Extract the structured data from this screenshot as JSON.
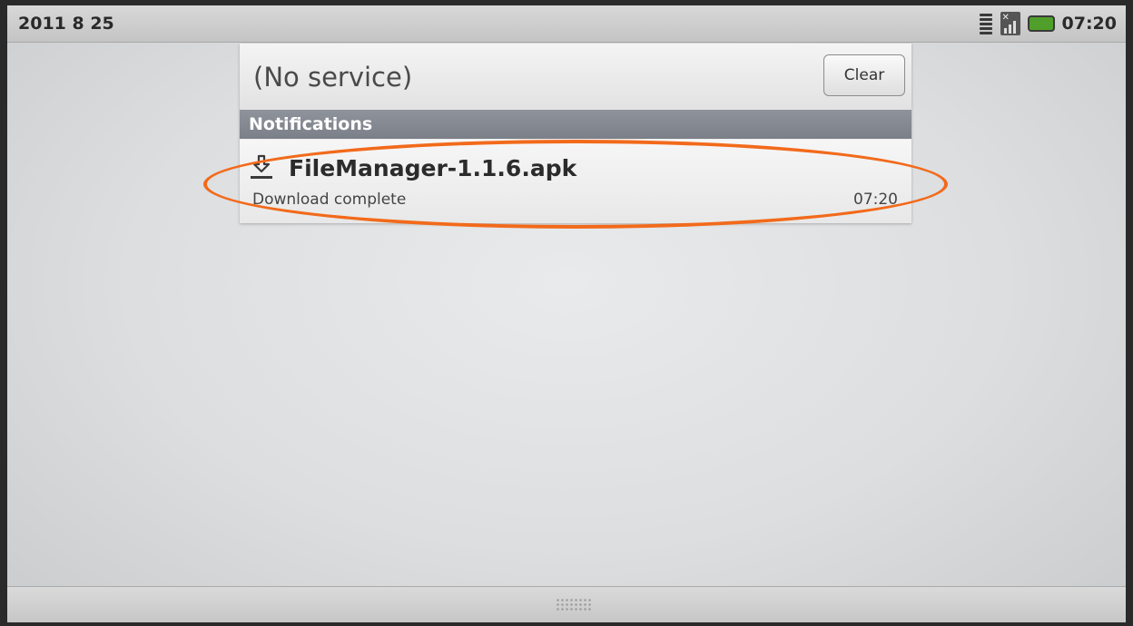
{
  "status_bar": {
    "date": "2011 8 25",
    "time": "07:20",
    "icons": [
      "wifi-icon",
      "signal-icon",
      "battery-icon"
    ]
  },
  "panel": {
    "operator": "(No service)",
    "clear_label": "Clear",
    "section_title": "Notifications"
  },
  "notification": {
    "icon": "download-icon",
    "title": "FileManager-1.1.6.apk",
    "text": "Download complete",
    "time": "07:20"
  },
  "colors": {
    "highlight": "#f26a1b",
    "section_header": "#858991",
    "battery": "#4f9f2a"
  }
}
